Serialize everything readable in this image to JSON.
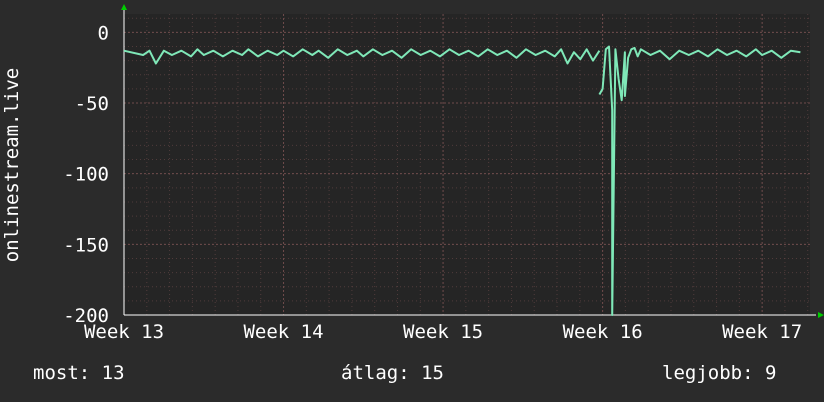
{
  "chart_data": {
    "type": "line",
    "title": "",
    "ylabel": "onlinestream.live",
    "xlabel": "",
    "ylim": [
      -200,
      13
    ],
    "y_ticks": [
      "0",
      "-50",
      "-100",
      "-150",
      "-200"
    ],
    "y_tick_values": [
      0,
      -50,
      -100,
      -150,
      -200
    ],
    "x_range": [
      13,
      17.3
    ],
    "x_ticks": [
      "Week 13",
      "Week 14",
      "Week 15",
      "Week 16",
      "Week 17"
    ],
    "x_tick_values": [
      13,
      14,
      15,
      16,
      17
    ],
    "grid": true,
    "series": [
      {
        "color": "#7fe8b8",
        "segments": [
          {
            "x": [
              13.0,
              13.12,
              13.16,
              13.2,
              13.25,
              13.3,
              13.36,
              13.42,
              13.46,
              13.5,
              13.56,
              13.62,
              13.68,
              13.74,
              13.78,
              13.84,
              13.9,
              13.96,
              14.0,
              14.06,
              14.12,
              14.18,
              14.22,
              14.28,
              14.34,
              14.4,
              14.46,
              14.5,
              14.56,
              14.62,
              14.68,
              14.74,
              14.8,
              14.86,
              14.92,
              14.98,
              15.04,
              15.1,
              15.16,
              15.22,
              15.28,
              15.34,
              15.4,
              15.46,
              15.52,
              15.58,
              15.64,
              15.7,
              15.74,
              15.78,
              15.82,
              15.86,
              15.9,
              15.94,
              15.98
            ],
            "y": [
              -13,
              -16,
              -13,
              -22,
              -13,
              -16,
              -13,
              -17,
              -12,
              -16,
              -13,
              -17,
              -13,
              -16,
              -12,
              -17,
              -13,
              -16,
              -13,
              -17,
              -12,
              -16,
              -13,
              -18,
              -12,
              -16,
              -13,
              -17,
              -12,
              -16,
              -13,
              -18,
              -12,
              -16,
              -13,
              -17,
              -12,
              -16,
              -13,
              -17,
              -12,
              -16,
              -13,
              -18,
              -12,
              -16,
              -13,
              -17,
              -12,
              -22,
              -14,
              -19,
              -12,
              -20,
              -13
            ]
          },
          {
            "x": [
              15.98,
              16.0,
              16.02,
              16.04,
              16.06,
              16.06,
              16.08,
              16.1,
              16.12,
              16.14,
              16.14,
              16.16,
              16.18,
              16.2,
              16.22,
              16.24,
              16.3,
              16.36,
              16.42,
              16.48,
              16.54,
              16.6,
              16.66,
              16.72,
              16.78,
              16.84,
              16.9,
              16.96,
              17.0,
              17.06,
              17.12,
              17.18,
              17.24
            ],
            "y": [
              -44,
              -40,
              -12,
              -10,
              -55,
              -200,
              -12,
              -33,
              -48,
              -14,
              -45,
              -18,
              -12,
              -11,
              -17,
              -12,
              -16,
              -13,
              -19,
              -13,
              -16,
              -13,
              -17,
              -12,
              -16,
              -13,
              -17,
              -12,
              -16,
              -13,
              -18,
              -13,
              -14
            ]
          }
        ]
      }
    ]
  },
  "stats": {
    "now": "most: 13",
    "avg": "átlag: 15",
    "best": "legjobb: 9"
  },
  "colors": {
    "background": "#2b2b2b",
    "plot_background": "#252525",
    "grid": "#6e4b4b",
    "line": "#7fe8b8",
    "axis_arrow": "#00cc00"
  }
}
